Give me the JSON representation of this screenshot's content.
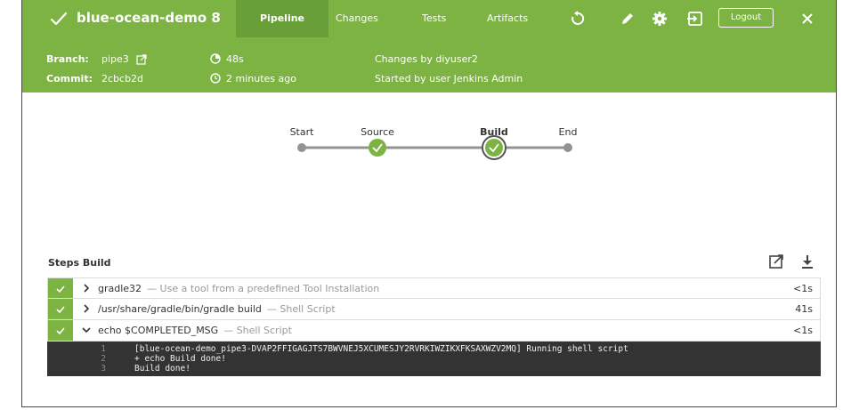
{
  "header": {
    "title": "blue-ocean-demo 8",
    "tabs": [
      "Pipeline",
      "Changes",
      "Tests",
      "Artifacts"
    ],
    "active_tab": "Pipeline",
    "logout_label": "Logout",
    "accent_color": "#7cb342",
    "icons": [
      "check-icon",
      "replay-icon",
      "edit-icon",
      "gear-icon",
      "exit-icon",
      "close-icon"
    ]
  },
  "info": {
    "branch_label": "Branch:",
    "branch_value": "pipe3",
    "commit_label": "Commit:",
    "commit_value": "2cbcb2d",
    "duration": "48s",
    "time_ago": "2 minutes ago",
    "changes": "Changes by diyuser2",
    "started_by": "Started by user Jenkins Admin"
  },
  "pipeline": {
    "stages": [
      {
        "label": "Start",
        "status": "none"
      },
      {
        "label": "Source",
        "status": "success"
      },
      {
        "label": "Build",
        "status": "success",
        "selected": true
      },
      {
        "label": "End",
        "status": "none"
      }
    ]
  },
  "steps": {
    "title": "Steps Build",
    "items": [
      {
        "name": "gradle32",
        "desc": "— Use a tool from a predefined Tool Installation",
        "duration": "<1s",
        "expanded": false
      },
      {
        "name": "/usr/share/gradle/bin/gradle build",
        "desc": "— Shell Script",
        "duration": "41s",
        "expanded": false
      },
      {
        "name": "echo $COMPLETED_MSG",
        "desc": "— Shell Script",
        "duration": "<1s",
        "expanded": true
      }
    ],
    "log": [
      {
        "num": "1",
        "text": "[blue-ocean-demo_pipe3-DVAP2FFIGAGJTS7BWVNEJ5XCUMESJY2RVRKIWZIKXFKSAXWZV2MQ] Running shell script"
      },
      {
        "num": "2",
        "text": "+ echo Build done!"
      },
      {
        "num": "3",
        "text": "Build done!"
      }
    ]
  }
}
